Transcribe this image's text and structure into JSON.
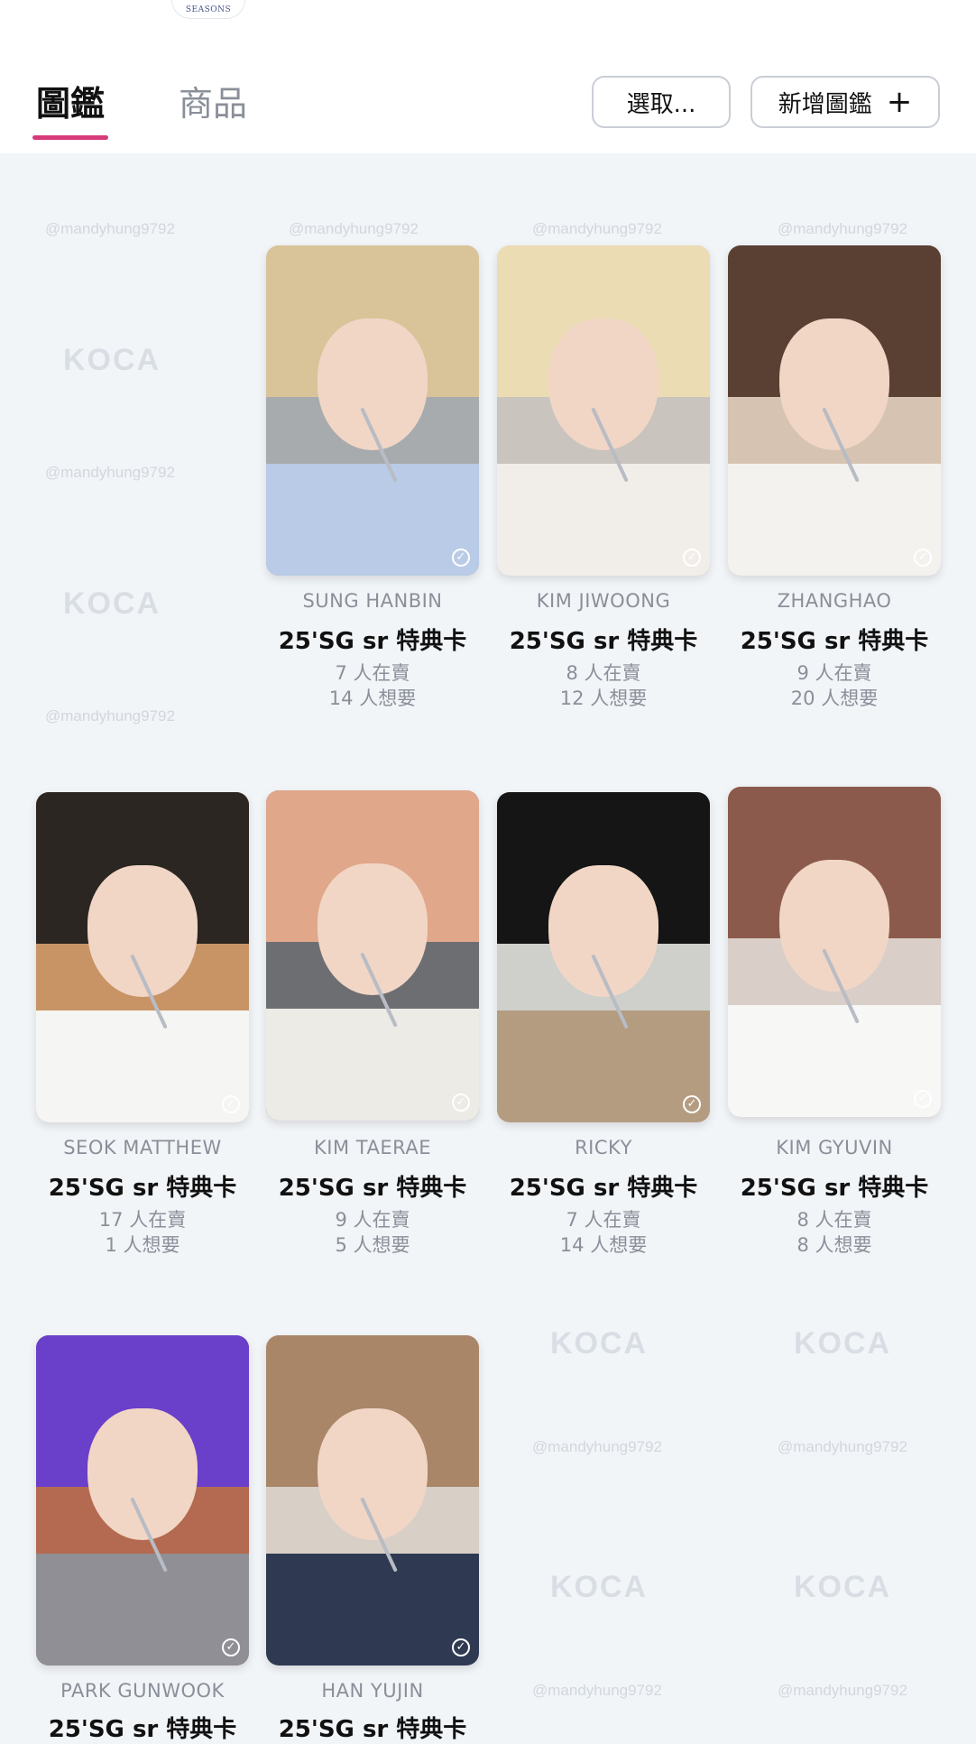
{
  "header": {
    "logo_text": "SEASONS",
    "tabs": [
      {
        "label": "圖鑑",
        "active": true
      },
      {
        "label": "商品",
        "active": false
      }
    ],
    "select_button": "選取...",
    "add_button": "新增圖鑑",
    "add_icon": "plus-icon"
  },
  "watermark": {
    "logo": "KOCA",
    "handle": "@mandyhung9792"
  },
  "colors": {
    "accent": "#d63a7a",
    "background": "#f2f5f8",
    "muted_text": "#8a8f99"
  },
  "cards": [
    {
      "member": "SUNG HANBIN",
      "title": "25'SG sr 特典卡",
      "selling": "7 人在賣",
      "wanted": "14 人想要",
      "icon": "check-circle-icon"
    },
    {
      "member": "KIM JIWOONG",
      "title": "25'SG sr 特典卡",
      "selling": "8 人在賣",
      "wanted": "12 人想要",
      "icon": "check-circle-icon"
    },
    {
      "member": "ZHANGHAO",
      "title": "25'SG sr 特典卡",
      "selling": "9 人在賣",
      "wanted": "20 人想要",
      "icon": "check-circle-icon"
    },
    {
      "member": "SEOK MATTHEW",
      "title": "25'SG sr 特典卡",
      "selling": "17 人在賣",
      "wanted": "1 人想要",
      "icon": "check-circle-icon"
    },
    {
      "member": "KIM TAERAE",
      "title": "25'SG sr 特典卡",
      "selling": "9 人在賣",
      "wanted": "5 人想要",
      "icon": "check-circle-icon"
    },
    {
      "member": "RICKY",
      "title": "25'SG sr 特典卡",
      "selling": "7 人在賣",
      "wanted": "14 人想要",
      "icon": "check-circle-icon"
    },
    {
      "member": "KIM GYUVIN",
      "title": "25'SG sr 特典卡",
      "selling": "8 人在賣",
      "wanted": "8 人想要",
      "icon": "check-circle-icon"
    },
    {
      "member": "PARK GUNWOOK",
      "title": "25'SG sr 特典卡",
      "icon": "check-circle-icon"
    },
    {
      "member": "HAN YUJIN",
      "title": "25'SG sr 特典卡",
      "icon": "check-circle-icon"
    }
  ]
}
